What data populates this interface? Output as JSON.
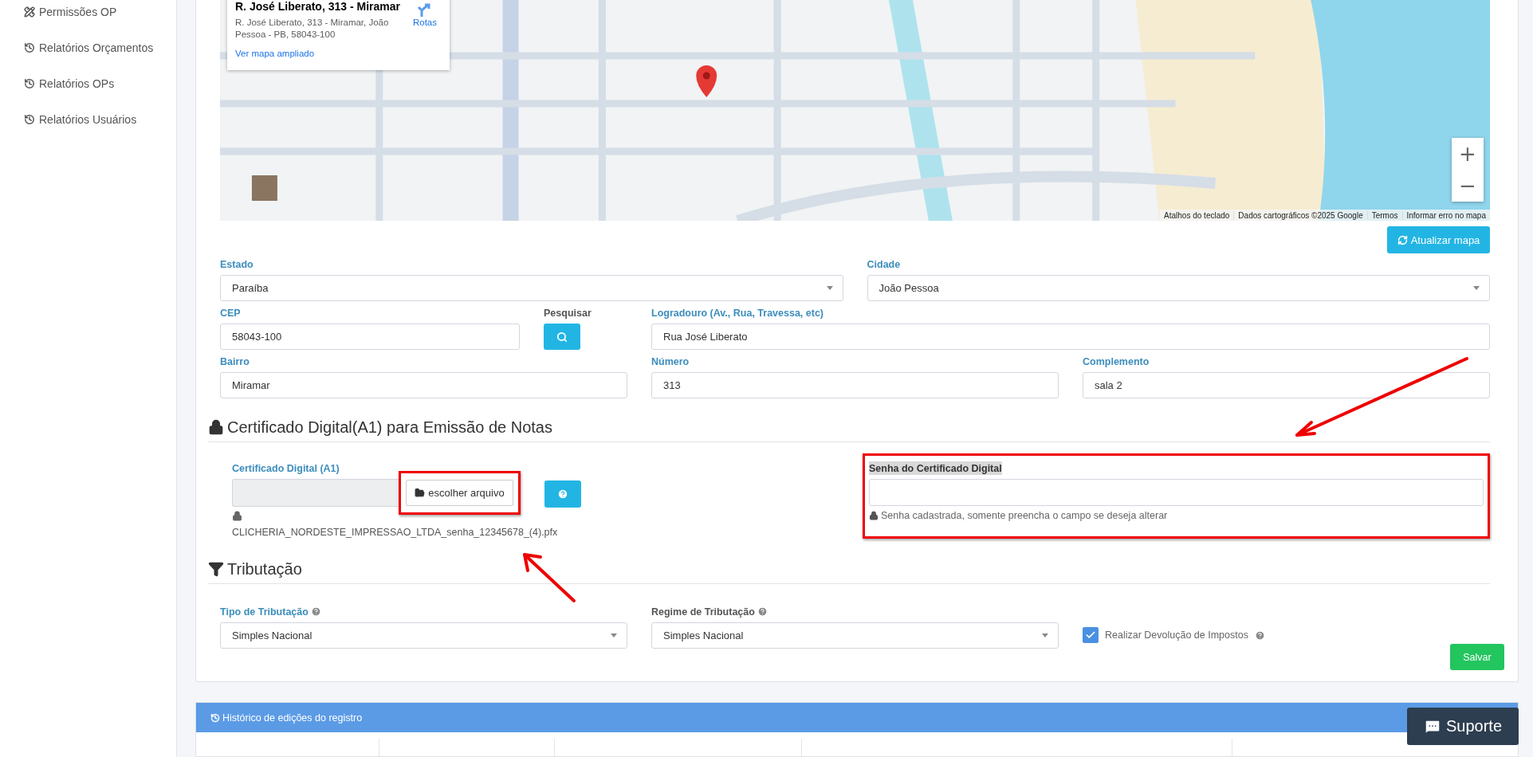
{
  "sidebar": {
    "items": [
      {
        "label": "Permissões OP",
        "kind": "permissions"
      },
      {
        "label": "Relatórios Orçamentos",
        "kind": "report"
      },
      {
        "label": "Relatórios OPs",
        "kind": "report"
      },
      {
        "label": "Relatórios Usuários",
        "kind": "report"
      }
    ]
  },
  "map": {
    "place_card": {
      "title": "R. José Liberato, 313 - Miramar",
      "address": "R. José Liberato, 313 - Miramar, João Pessoa - PB, 58043-100",
      "directions": "Rotas",
      "link": "Ver mapa ampliado"
    },
    "zoom_in": "+",
    "zoom_out": "−",
    "attribution": [
      "Atalhos do teclado",
      "Dados cartográficos ©2025 Google",
      "Termos",
      "Informar erro no mapa"
    ]
  },
  "refresh_button": "Atualizar mapa",
  "address_rows": [
    [
      {
        "kind": "select",
        "label": "Estado",
        "value": "Paraíba",
        "required": true
      },
      {
        "kind": "select",
        "label": "Cidade",
        "value": "João Pessoa",
        "required": true
      }
    ],
    [
      {
        "kind": "input",
        "label": "CEP",
        "value": "58043-100",
        "required": true
      },
      {
        "kind": "search",
        "label": "Pesquisar",
        "required": false
      },
      {
        "kind": "input",
        "label": "Logradouro (Av., Rua, Travessa, etc)",
        "value": "Rua José Liberato",
        "required": true
      }
    ],
    [
      {
        "kind": "input",
        "label": "Bairro",
        "value": "Miramar",
        "required": true
      },
      {
        "kind": "input",
        "label": "Número",
        "value": "313",
        "required": true
      },
      {
        "kind": "input",
        "label": "Complemento",
        "value": "sala 2",
        "required": true
      }
    ]
  ],
  "certificate_section": {
    "title": "Certificado Digital(A1) para Emissão de Notas",
    "file_label": "Certificado Digital (A1)",
    "file_button": "escolher arquivo",
    "file_button_highlighted": true,
    "file_name": "CLICHERIA_NORDESTE_IMPRESSAO_LTDA_senha_12345678_(4).pfx",
    "password_label": "Senha do Certificado Digital",
    "password_highlighted": true,
    "password_hint": "Senha cadastrada, somente preencha o campo se deseja alterar"
  },
  "tax_section": {
    "title": "Tributação",
    "fields": [
      {
        "kind": "select",
        "label": "Tipo de Tributação",
        "value": "Simples Nacional",
        "required": true
      },
      {
        "kind": "select",
        "label": "Regime de Tributação",
        "value": "Simples Nacional",
        "required": false
      },
      {
        "kind": "checkbox",
        "label": "Realizar Devolução de Impostos",
        "checked": true
      }
    ],
    "save_button": "Salvar"
  },
  "history_panel": {
    "title": "Histórico de edições do registro"
  },
  "support_button": "Suporte",
  "annotations": [
    {
      "kind": "arrow"
    },
    {
      "kind": "arrow"
    }
  ]
}
